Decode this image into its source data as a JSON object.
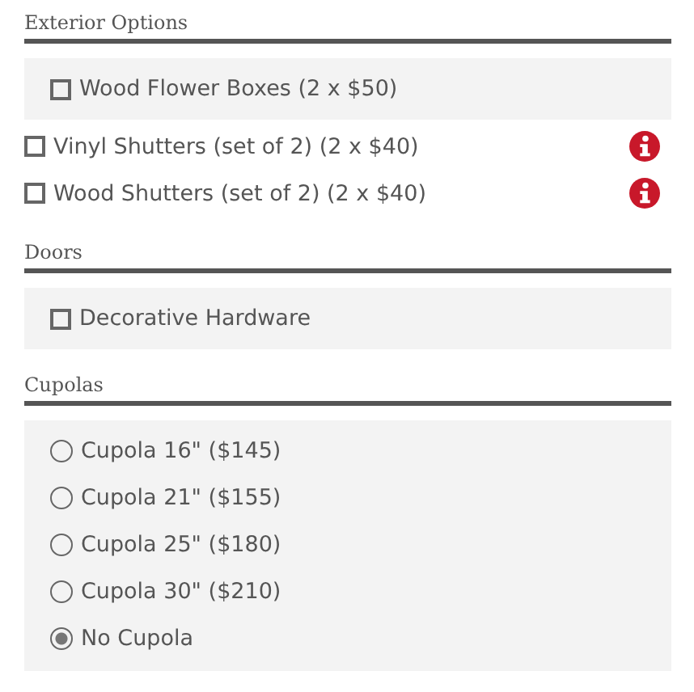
{
  "sections": [
    {
      "title": "Exterior Options",
      "groups": [
        {
          "shaded": true,
          "items": [
            {
              "kind": "checkbox",
              "label": "Wood Flower Boxes (2 x $50)",
              "checked": false,
              "info": false
            }
          ]
        },
        {
          "shaded": false,
          "items": [
            {
              "kind": "checkbox",
              "label": "Vinyl Shutters (set of 2) (2 x $40)",
              "checked": false,
              "info": true
            },
            {
              "kind": "checkbox",
              "label": "Wood Shutters (set of 2) (2 x $40)",
              "checked": false,
              "info": true
            }
          ]
        }
      ]
    },
    {
      "title": "Doors",
      "groups": [
        {
          "shaded": true,
          "items": [
            {
              "kind": "checkbox",
              "label": "Decorative Hardware",
              "checked": false,
              "info": false
            }
          ]
        }
      ]
    },
    {
      "title": "Cupolas",
      "groups": [
        {
          "shaded": true,
          "items": [
            {
              "kind": "radio",
              "label": "Cupola 16\" ($145)",
              "selected": false
            },
            {
              "kind": "radio",
              "label": "Cupola 21\" ($155)",
              "selected": false
            },
            {
              "kind": "radio",
              "label": "Cupola 25\" ($180)",
              "selected": false
            },
            {
              "kind": "radio",
              "label": "Cupola 30\" ($210)",
              "selected": false
            },
            {
              "kind": "radio",
              "label": "No Cupola",
              "selected": true
            }
          ]
        }
      ]
    }
  ]
}
